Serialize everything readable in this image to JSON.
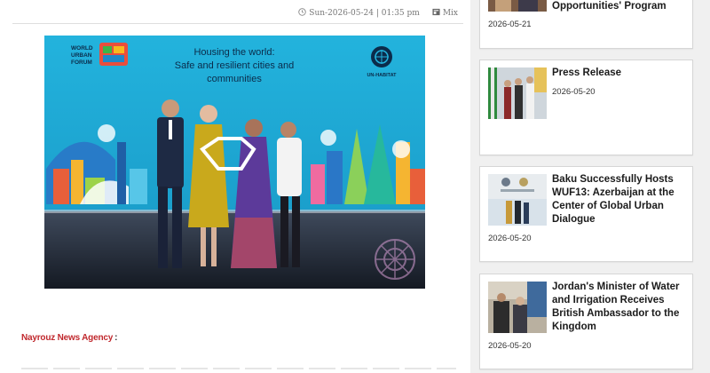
{
  "article": {
    "date_text": "Sun-2026-05-24 | 01:35 pm",
    "category": "Mix",
    "image": {
      "banner_title_line1": "Housing the world:",
      "banner_title_line2": "Safe and resilient cities and",
      "banner_title_line3": "communities",
      "forum_logo_line1": "WORLD",
      "forum_logo_line2": "URBAN",
      "forum_logo_line3": "FORUM",
      "un_logo_label": "UN-HABITAT"
    },
    "agency_label": "Nayrouz News Agency",
    "agency_colon": ":"
  },
  "sidebar": {
    "cards": [
      {
        "title": "Opportunities' Program",
        "date": "2026-05-21"
      },
      {
        "title": "Press Release",
        "date": "2026-05-20"
      },
      {
        "title": "Baku Successfully Hosts WUF13: Azerbaijan at the Center of Global Urban Dialogue",
        "date": "2026-05-20"
      },
      {
        "title": "Jordan's Minister of Water and Irrigation Receives British Ambassador to the Kingdom",
        "date": "2026-05-20"
      }
    ]
  },
  "colors": {
    "agency_red": "#c0282d",
    "banner_blue": "#19a6cf"
  },
  "icons": [
    "clock-icon",
    "category-icon"
  ]
}
